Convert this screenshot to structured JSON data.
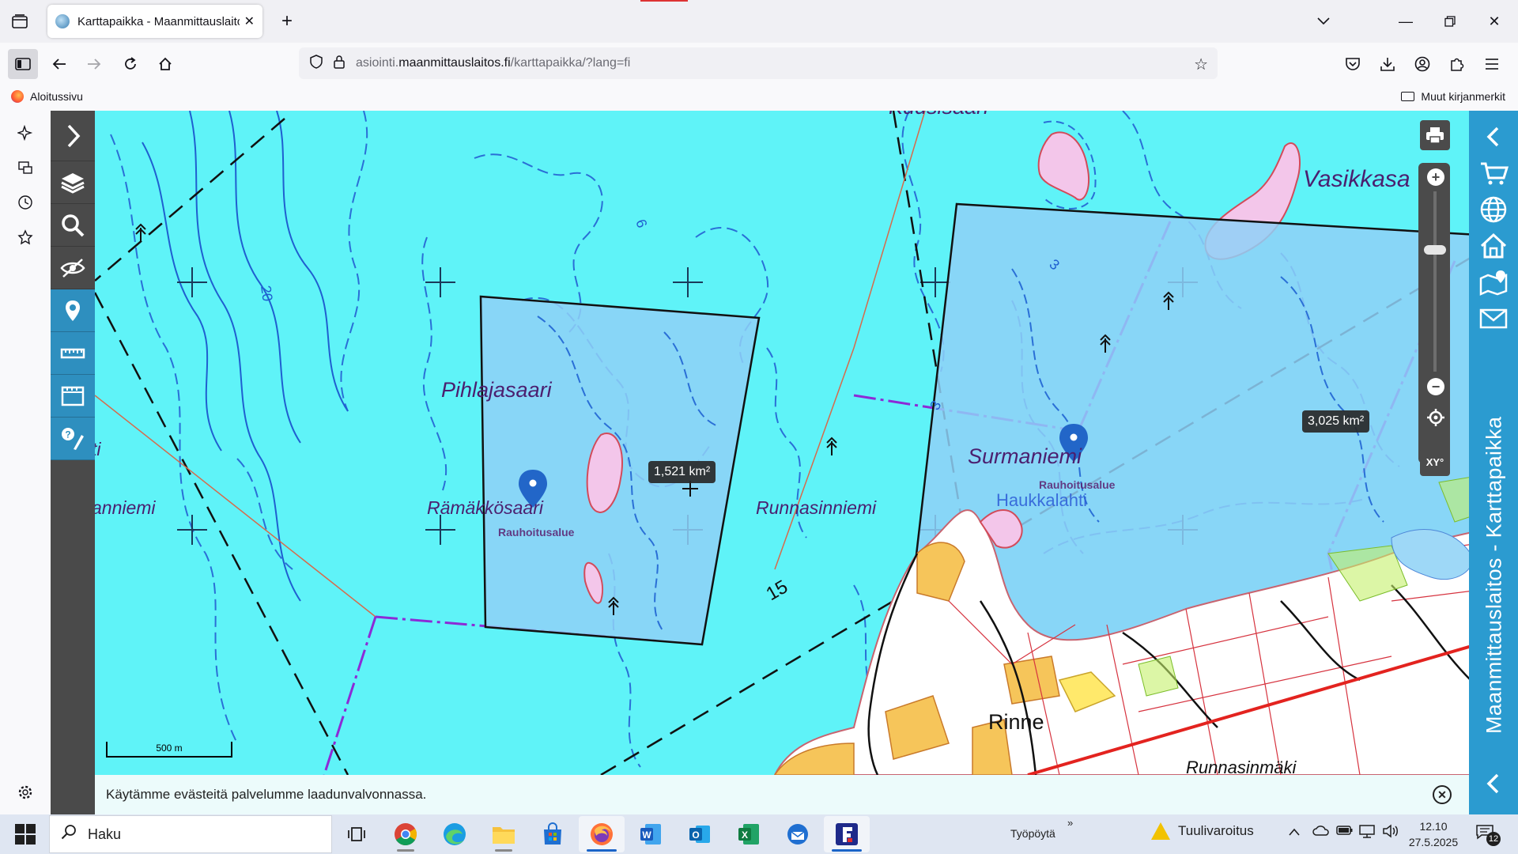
{
  "browser": {
    "tab_title": "Karttapaikka - Maanmittauslaitos",
    "url_host_prefix": "asiointi.",
    "url_domain": "maanmittauslaitos.fi",
    "url_path": "/karttapaikka/?lang=fi",
    "bookmark_home": "Aloitussivu",
    "bookmark_other": "Muut kirjanmerkit"
  },
  "map": {
    "labels": {
      "kuusisaari": "Kuusisaari",
      "vasikkasaari": "Vasikkasa",
      "pihlajasaari": "Pihlajasaari",
      "ramakkosaari": "Rämäkkösaari",
      "runnasinniemi": "Runnasinniemi",
      "surmaniemi": "Surmaniemi",
      "haukkalahti": "Haukkalahti",
      "rinne": "Rinne",
      "runnasinmaki": "Runnasinmäki",
      "anniemi": "anniemi",
      "ti": "ti",
      "rauhoitusalue_1": "Rauhoitusalue",
      "rauhoitusalue_2": "Rauhoitusalue",
      "depth_20": "20",
      "depth_6": "6",
      "depth_3a": "3",
      "depth_3b": "3",
      "depth_15": "15"
    },
    "area_1": "1,521 km²",
    "area_2": "3,025 km²",
    "scale": "500 m",
    "xy_label": "XY°"
  },
  "right_panel": {
    "title": "Maanmittauslaitos - Karttapaikka"
  },
  "cookie": {
    "text": "Käytämme evästeitä palvelumme laadunvalvonnassa."
  },
  "taskbar": {
    "search_placeholder": "Haku",
    "desktop_label": "Työpöytä",
    "weather_text": "Tuulivaroitus",
    "time": "12.10",
    "date": "27.5.2025",
    "notification_count": "12"
  },
  "colors": {
    "water": "#5ff3f8",
    "selection": "#8fd0f7",
    "accent": "#2b9bd0",
    "toolbar": "#4a4a4a"
  }
}
